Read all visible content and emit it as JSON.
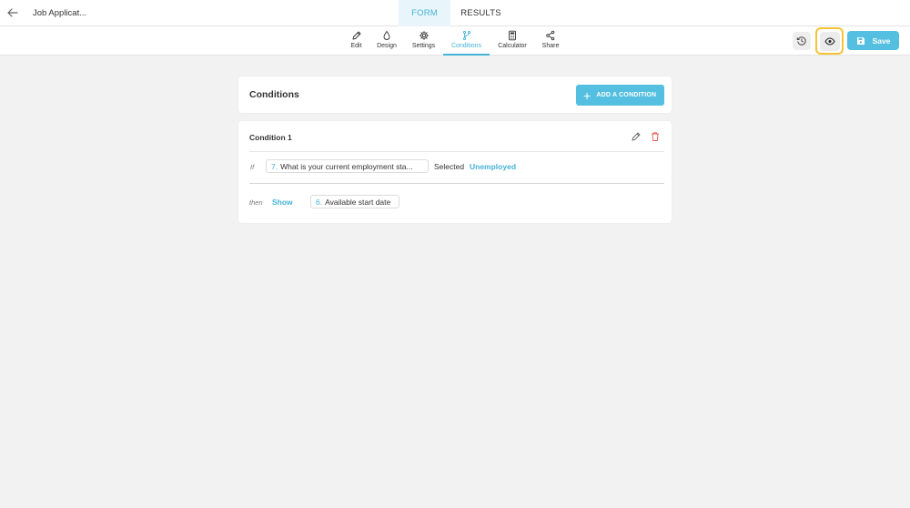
{
  "header": {
    "form_title": "Job Applicat...",
    "tabs": [
      {
        "label": "FORM",
        "active": true
      },
      {
        "label": "RESULTS",
        "active": false
      }
    ]
  },
  "toolbar": {
    "items": [
      {
        "label": "Edit",
        "icon": "pencil-icon"
      },
      {
        "label": "Design",
        "icon": "droplet-icon"
      },
      {
        "label": "Settings",
        "icon": "gear-icon"
      },
      {
        "label": "Conditions",
        "icon": "branch-icon",
        "active": true
      },
      {
        "label": "Calculator",
        "icon": "calculator-icon"
      },
      {
        "label": "Share",
        "icon": "share-icon"
      }
    ],
    "save_label": "Save",
    "history_icon": "history-icon",
    "preview_icon": "eye-icon"
  },
  "conditions": {
    "title": "Conditions",
    "add_label": "ADD A CONDITION",
    "items": [
      {
        "title": "Condition 1",
        "if_label": "If",
        "question_number": "7.",
        "question_text": "What is your current employment sta...",
        "operator": "Selected",
        "value": "Unemployed",
        "then_label": "then",
        "action": "Show",
        "target_number": "6.",
        "target_text": "Available start date"
      }
    ]
  },
  "colors": {
    "accent": "#54bfe0",
    "accent_text": "#45b2d7",
    "highlight": "#f7c234",
    "delete": "#e0584f"
  }
}
